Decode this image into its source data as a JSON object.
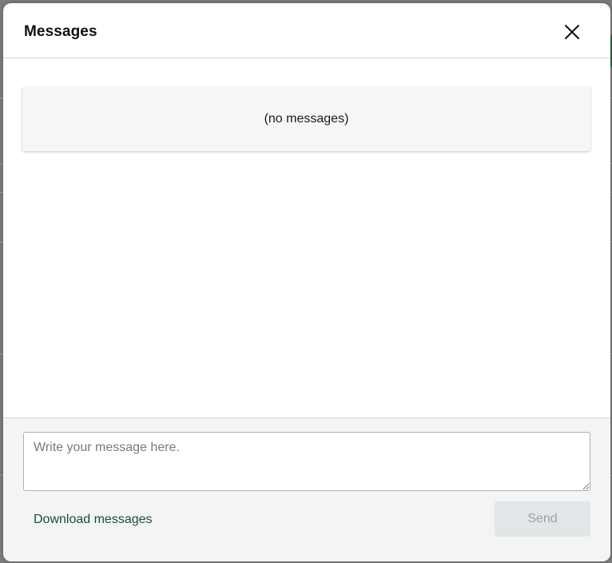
{
  "dialog": {
    "title": "Messages",
    "close_icon": "close-icon"
  },
  "messages": {
    "empty_text": "(no messages)",
    "items": []
  },
  "composer": {
    "placeholder": "Write your message here.",
    "value": "",
    "download_label": "Download messages",
    "send_label": "Send",
    "send_enabled": false
  },
  "colors": {
    "link": "#1d4a36",
    "send_disabled_bg": "#e3e6e8",
    "send_disabled_text": "#9aa0a4"
  }
}
